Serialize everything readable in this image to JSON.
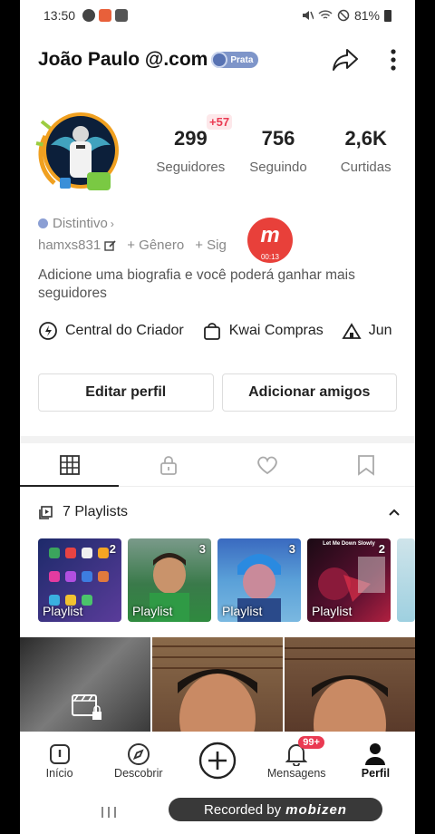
{
  "status_bar": {
    "time": "13:50",
    "battery": "81%"
  },
  "header": {
    "username": "João Paulo @.com",
    "badge": "Prata"
  },
  "profile": {
    "new_followers": "+57",
    "stats": [
      {
        "value": "299",
        "label": "Seguidores"
      },
      {
        "value": "756",
        "label": "Seguindo"
      },
      {
        "value": "2,6K",
        "label": "Curtidas"
      }
    ],
    "distintivo": "Distintivo",
    "handle": "hamxs831",
    "genero": "+ Gênero",
    "signo": "+ Sig",
    "bio": "Adicione uma biografia e você poderá ganhar mais seguidores"
  },
  "overlay": {
    "timer": "00:13"
  },
  "shortcuts": [
    {
      "label": "Central do Criador",
      "icon": "lightning-icon"
    },
    {
      "label": "Kwai Compras",
      "icon": "shopping-bag-icon"
    },
    {
      "label": "Jun",
      "icon": "tent-icon"
    }
  ],
  "buttons": {
    "edit": "Editar perfil",
    "add_friends": "Adicionar amigos"
  },
  "playlists": {
    "title": "7 Playlists",
    "items": [
      {
        "label": "Playlist",
        "count": "2"
      },
      {
        "label": "Playlist",
        "count": "3"
      },
      {
        "label": "Playlist",
        "count": "3"
      },
      {
        "label": "Playlist",
        "count": "2",
        "subtitle": "Let Me Down Slowly"
      }
    ]
  },
  "bottom_nav": {
    "items": [
      {
        "label": "Início",
        "icon": "home-icon"
      },
      {
        "label": "Descobrir",
        "icon": "compass-icon"
      },
      {
        "label": "",
        "icon": "plus-icon"
      },
      {
        "label": "Mensagens",
        "icon": "bell-icon",
        "badge": "99+"
      },
      {
        "label": "Perfil",
        "icon": "person-icon"
      }
    ]
  },
  "recorder": {
    "text": "Recorded by",
    "brand": "mobizen"
  },
  "colors": {
    "accent": "#ea3a52",
    "badge": "#7e95c9",
    "recorder": "#e8403a"
  }
}
